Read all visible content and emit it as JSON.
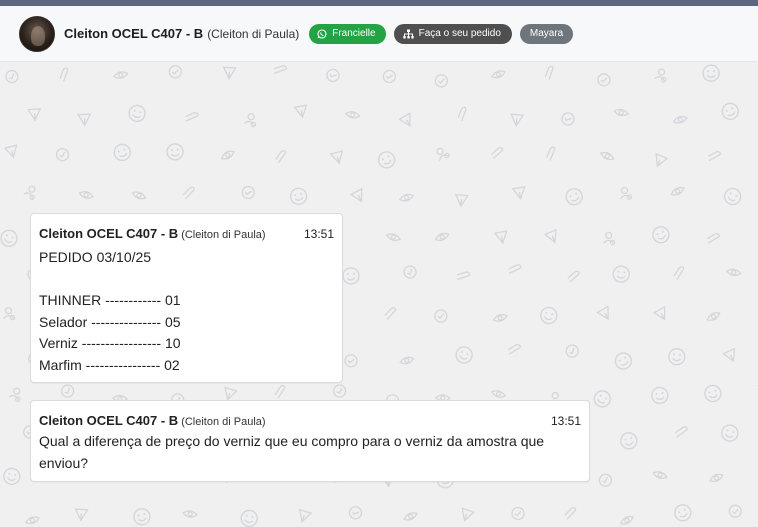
{
  "header": {
    "contact_name": "Cleiton OCEL C407 - B",
    "contact_subtitle": "(Cleiton di Paula)",
    "tags": [
      {
        "label": "Francielle",
        "icon": "whatsapp-icon",
        "color": "#25a244"
      },
      {
        "label": "Faça o seu pedido",
        "icon": "sitemap-icon",
        "color": "#4f4f4f"
      },
      {
        "label": "Mayara",
        "color": "#6e757c"
      }
    ]
  },
  "messages": [
    {
      "sender": "Cleiton OCEL C407 - B",
      "sender_subtitle": "(Cleiton di Paula)",
      "time": "13:51",
      "text": "PEDIDO 03/10/25\n\nTHINNER ------------ 01\nSelador --------------- 05\nVerniz ----------------- 10\nMarfim ---------------- 02"
    },
    {
      "sender": "Cleiton OCEL C407 - B",
      "sender_subtitle": "(Cleiton di Paula)",
      "time": "13:51",
      "text": "Qual a diferença de preço do verniz que eu compro para o verniz da amostra que enviou?"
    }
  ]
}
